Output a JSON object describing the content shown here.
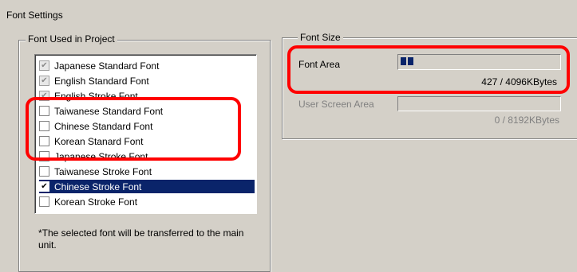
{
  "window": {
    "title": "Font Settings"
  },
  "font_used": {
    "legend": "Font Used in Project",
    "items": [
      {
        "label": "Japanese Standard Font",
        "checked": true,
        "disabled": true
      },
      {
        "label": "English Standard Font",
        "checked": true,
        "disabled": true
      },
      {
        "label": "English Stroke Font",
        "checked": true,
        "disabled": true
      },
      {
        "label": "Taiwanese Standard Font",
        "checked": false,
        "disabled": false
      },
      {
        "label": "Chinese Standard Font",
        "checked": false,
        "disabled": false
      },
      {
        "label": "Korean Stanard Font",
        "checked": false,
        "disabled": false
      },
      {
        "label": "Japanese Stroke Font",
        "checked": false,
        "disabled": false
      },
      {
        "label": "Taiwanese Stroke Font",
        "checked": false,
        "disabled": false
      },
      {
        "label": "Chinese Stroke Font",
        "checked": true,
        "disabled": false,
        "selected": true
      },
      {
        "label": "Korean Stroke Font",
        "checked": false,
        "disabled": false
      }
    ],
    "note": "*The selected font will be transferred to the main unit."
  },
  "font_size": {
    "legend": "Font Size",
    "font_area": {
      "label": "Font Area",
      "usage": "427 / 4096KBytes",
      "used": 427,
      "total": 4096
    },
    "user_screen_area": {
      "label": "User Screen Area",
      "usage": "0 / 8192KBytes",
      "used": 0,
      "total": 8192
    }
  },
  "colors": {
    "highlight": "#ff0000",
    "selection": "#0a246a",
    "face": "#d4d0c8"
  }
}
